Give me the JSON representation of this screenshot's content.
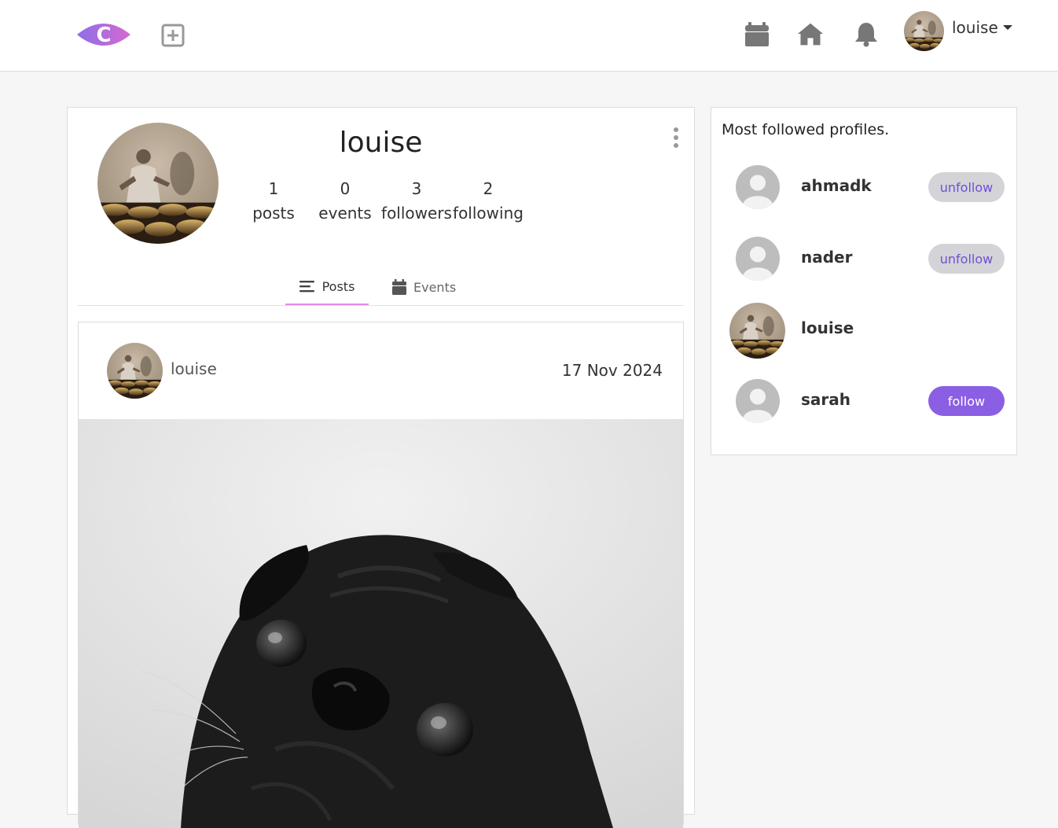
{
  "navbar": {
    "logo_letter": "C",
    "username": "louise"
  },
  "profile": {
    "name": "louise",
    "stats": [
      {
        "value": "1",
        "label": "posts"
      },
      {
        "value": "0",
        "label": "events"
      },
      {
        "value": "3",
        "label": "followers"
      },
      {
        "value": "2",
        "label": "following"
      }
    ],
    "tabs": [
      {
        "label": "Posts",
        "active": true
      },
      {
        "label": "Events",
        "active": false
      }
    ]
  },
  "post": {
    "author": "louise",
    "date": "17 Nov 2024"
  },
  "sidebar": {
    "title": "Most followed profiles.",
    "profiles": [
      {
        "name": "ahmadk",
        "button": "unfollow"
      },
      {
        "name": "nader",
        "button": "unfollow"
      },
      {
        "name": "louise",
        "button": ""
      },
      {
        "name": "sarah",
        "button": "follow"
      }
    ]
  },
  "colors": {
    "accent": "#8b5fe3",
    "tab_underline": "#e08be8",
    "icon_gray": "#777777"
  }
}
